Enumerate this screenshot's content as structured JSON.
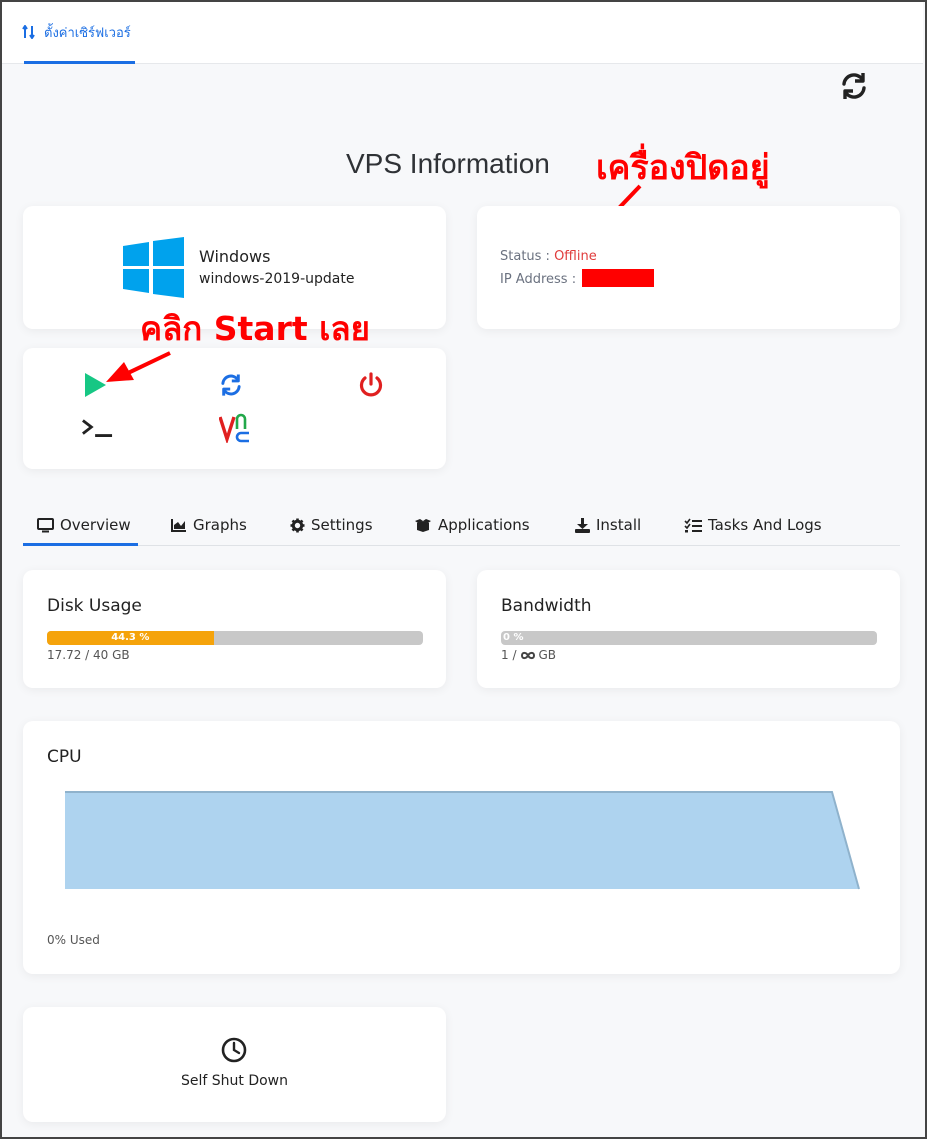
{
  "topbar": {
    "tab_label": "ตั้งค่าเซิร์ฟเวอร์"
  },
  "page": {
    "title": "VPS Information"
  },
  "annotations": {
    "offline_note": "เครื่องปิดอยู่",
    "start_note": "คลิก Start เลย"
  },
  "os": {
    "name": "Windows",
    "image": "windows-2019-update"
  },
  "status": {
    "status_label": "Status : ",
    "status_value": "Offline",
    "ip_label": "IP Address : ",
    "status_color": "#e03c3c"
  },
  "actions": [
    {
      "icon": "play-icon",
      "color": "#16c784"
    },
    {
      "icon": "restart-icon",
      "color": "#1b6ee3"
    },
    {
      "icon": "power-icon",
      "color": "#e02020"
    },
    {
      "icon": "terminal-icon",
      "color": "#222222"
    },
    {
      "icon": "vnc-icon",
      "color": "#e02020"
    }
  ],
  "tabs": [
    {
      "label": "Overview",
      "icon": "monitor-icon"
    },
    {
      "label": "Graphs",
      "icon": "area-chart-icon"
    },
    {
      "label": "Settings",
      "icon": "gear-icon"
    },
    {
      "label": "Applications",
      "icon": "boxes-icon"
    },
    {
      "label": "Install",
      "icon": "download-icon"
    },
    {
      "label": "Tasks And Logs",
      "icon": "tasks-icon"
    }
  ],
  "disk": {
    "title": "Disk Usage",
    "percent": 44.3,
    "percent_label": "44.3 %",
    "caption": "17.72 / 40 GB"
  },
  "bandwidth": {
    "title": "Bandwidth",
    "percent": 0,
    "percent_label": "0 %",
    "used": "1 /",
    "unit": "GB"
  },
  "cpu": {
    "title": "CPU",
    "caption": "0% Used"
  },
  "self_shutdown": {
    "label": "Self Shut Down"
  },
  "colors": {
    "accent": "#1b6ee3",
    "annotation": "#ff0000",
    "disk_bar": "#f5a30b",
    "cpu_fill": "#aed3ef"
  }
}
